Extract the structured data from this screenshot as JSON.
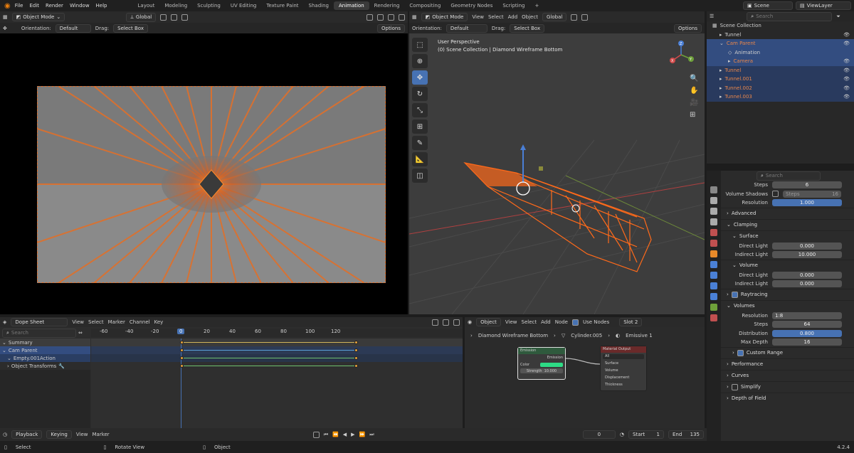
{
  "topbar": {
    "menu": [
      "File",
      "Edit",
      "Render",
      "Window",
      "Help"
    ],
    "workspaces": [
      "Layout",
      "Modeling",
      "Sculpting",
      "UV Editing",
      "Texture Paint",
      "Shading",
      "Animation",
      "Rendering",
      "Compositing",
      "Geometry Nodes",
      "Scripting"
    ],
    "active_workspace": "Animation",
    "add_tab": "+",
    "scene": "Scene",
    "view_layer": "ViewLayer"
  },
  "left_viewport": {
    "mode": "Object Mode",
    "transform": "Global",
    "orientation_label": "Orientation:",
    "orientation": "Default",
    "drag_label": "Drag:",
    "drag": "Select Box",
    "options": "Options"
  },
  "right_viewport": {
    "mode": "Object Mode",
    "menus": [
      "View",
      "Select",
      "Add",
      "Object"
    ],
    "transform": "Global",
    "orientation_label": "Orientation:",
    "orientation": "Default",
    "drag_label": "Drag:",
    "drag": "Select Box",
    "options": "Options",
    "overlay_title": "User Perspective",
    "overlay_sub": "(0) Scene Collection | Diamond Wireframe Bottom",
    "gizmo_x": "X",
    "gizmo_y": "Y",
    "gizmo_z": "Z"
  },
  "outliner": {
    "search_placeholder": "Search",
    "root": "Scene Collection",
    "items": [
      {
        "label": "Tunnel",
        "color": "#cfcfcf"
      },
      {
        "label": "Cam Parent",
        "color": "#e8864a"
      },
      {
        "label": "Animation",
        "color": "#cfcfcf"
      },
      {
        "label": "Camera",
        "color": "#e8864a"
      },
      {
        "label": "Tunnel",
        "color": "#e8864a"
      },
      {
        "label": "Tunnel.001",
        "color": "#e8864a"
      },
      {
        "label": "Tunnel.002",
        "color": "#e8864a"
      },
      {
        "label": "Tunnel.003",
        "color": "#e8864a"
      }
    ]
  },
  "properties": {
    "search_placeholder": "Search",
    "steps_label": "Steps",
    "steps_value": "6",
    "volume_shadows_label": "Volume Shadows",
    "shadow_steps_label": "Steps",
    "shadow_steps_value": "16",
    "resolution_label": "Resolution",
    "resolution_value": "1.000",
    "advanced": "Advanced",
    "clamping": "Clamping",
    "surface": "Surface",
    "direct_light": "Direct Light",
    "surface_direct": "0.000",
    "indirect_light": "Indirect Light",
    "surface_indirect": "10.000",
    "volume": "Volume",
    "volume_direct": "0.000",
    "volume_indirect": "0.000",
    "raytracing": "Raytracing",
    "volumes": "Volumes",
    "vol_resolution_label": "Resolution",
    "vol_resolution": "1:8",
    "vol_steps_label": "Steps",
    "vol_steps": "64",
    "distribution_label": "Distribution",
    "distribution": "0.800",
    "max_depth_label": "Max Depth",
    "max_depth": "16",
    "custom_range": "Custom Range",
    "performance": "Performance",
    "curves": "Curves",
    "simplify": "Simplify",
    "dof": "Depth of Field"
  },
  "dopesheet": {
    "editor": "Dope Sheet",
    "menus": [
      "View",
      "Select",
      "Marker",
      "Channel",
      "Key"
    ],
    "search_placeholder": "Search",
    "ruler": [
      "-60",
      "-40",
      "-20",
      "0",
      "20",
      "40",
      "60",
      "80",
      "100",
      "120"
    ],
    "channels": [
      "Summary",
      "Cam Parent",
      "Empty.001Action",
      "Object Transforms"
    ]
  },
  "node_editor": {
    "type": "Object",
    "menus": [
      "View",
      "Select",
      "Add",
      "Node"
    ],
    "use_nodes": "Use Nodes",
    "slot": "Slot 2",
    "breadcrumb": [
      "Diamond Wireframe Bottom",
      "Cylinder.005",
      "Emissive 1"
    ],
    "emission_title": "Emission",
    "emission_out": "Emission",
    "color_label": "Color",
    "strength_label": "Strength",
    "strength_value": "10.000",
    "output_title": "Material Output",
    "output_target": "All",
    "output_inputs": [
      "Surface",
      "Volume",
      "Displacement",
      "Thickness"
    ]
  },
  "timeline": {
    "playback": "Playback",
    "keying": "Keying",
    "view": "View",
    "marker": "Marker",
    "current_frame": "0",
    "start_label": "Start",
    "start": "1",
    "end_label": "End",
    "end": "135"
  },
  "status": {
    "select": "Select",
    "rotate": "Rotate View",
    "object": "Object",
    "version": "4.2.4"
  }
}
